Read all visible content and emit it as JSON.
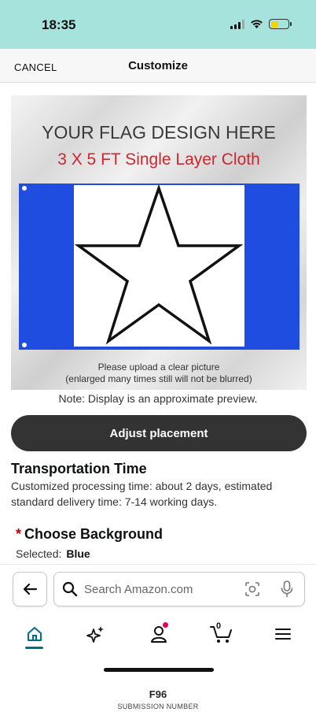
{
  "status_bar": {
    "time": "18:35"
  },
  "header": {
    "cancel_label": "CANCEL",
    "title": "Customize"
  },
  "preview": {
    "headline": "YOUR FLAG DESIGN HERE",
    "subheadline": "3 X 5 FT Single Layer Cloth",
    "note_line1": "Please upload a clear picture",
    "note_line2": "(enlarged many times still will not be blurred)",
    "flag_color": "#1f4de0"
  },
  "display_note": "Note: Display is an approximate preview.",
  "adjust_button_label": "Adjust placement",
  "transportation": {
    "title": "Transportation Time",
    "body": "Customized processing time: about 2 days, estimated standard delivery time: 7-14 working days."
  },
  "background": {
    "required_mark": "*",
    "title": "Choose Background",
    "selected_label": "Selected:",
    "selected_value": "Blue"
  },
  "search": {
    "placeholder": "Search Amazon.com"
  },
  "nav": {
    "items": [
      "home-icon",
      "sparkle-icon",
      "account-icon",
      "cart-icon",
      "menu-icon"
    ],
    "cart_count": "0"
  },
  "footer": {
    "submission_number": "F96",
    "submission_label": "SUBMISSION NUMBER"
  },
  "colors": {
    "accent": "#007185",
    "button_dark": "#333333",
    "status_bar": "#a6e3dc",
    "required": "#c40000"
  }
}
